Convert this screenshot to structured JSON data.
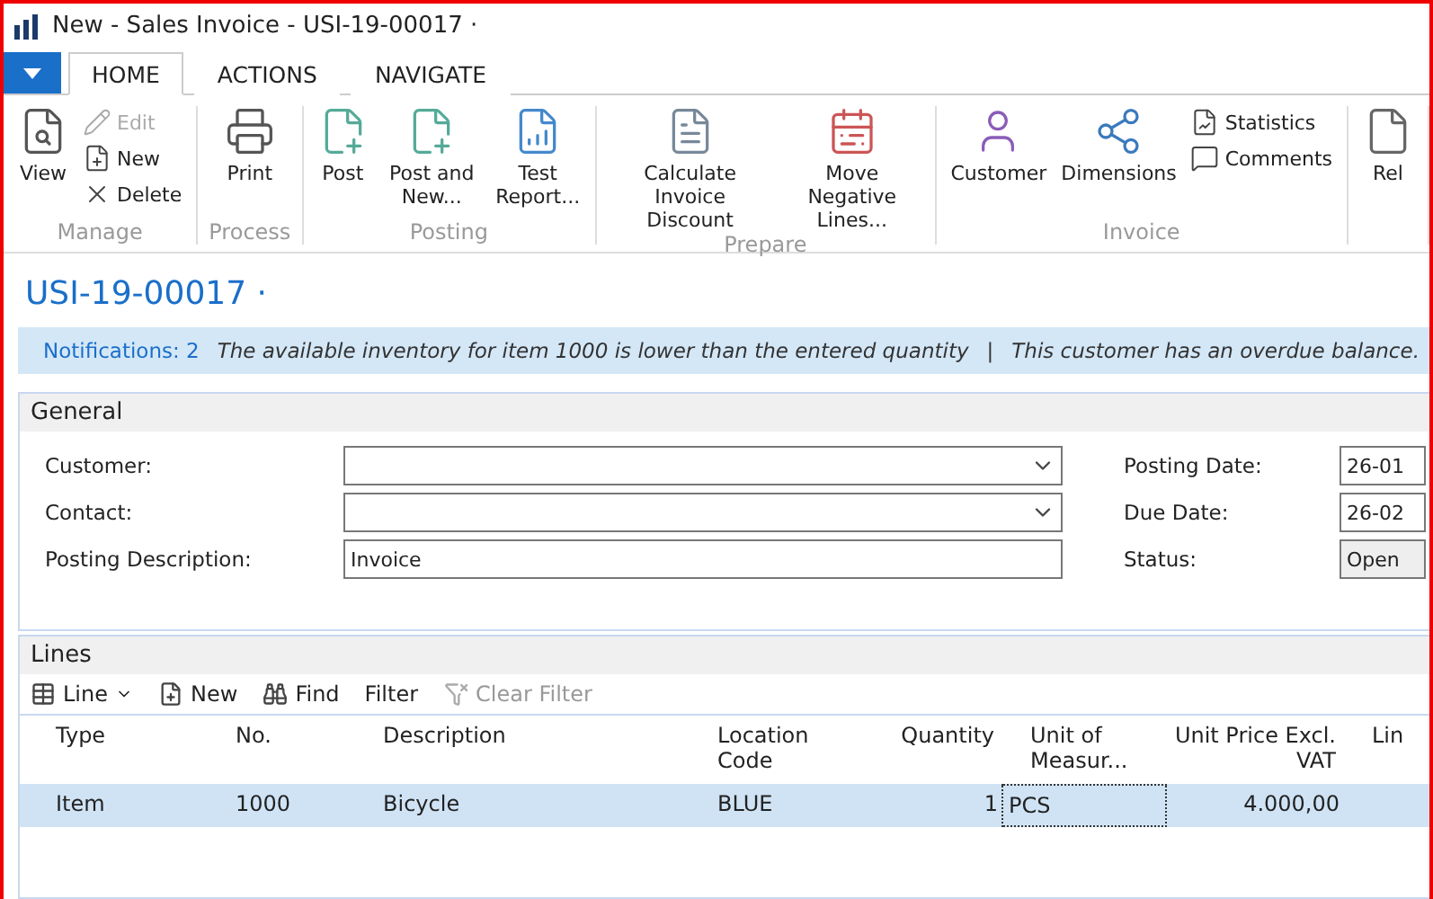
{
  "window": {
    "title": "New - Sales Invoice - USI-19-00017 ·"
  },
  "ribbon": {
    "tabs": [
      {
        "label": "HOME",
        "selected": true
      },
      {
        "label": "ACTIONS",
        "selected": false
      },
      {
        "label": "NAVIGATE",
        "selected": false
      }
    ],
    "groups": [
      {
        "label": "Manage",
        "buttons": [
          {
            "label": "View",
            "kind": "large",
            "disabled": false
          },
          {
            "label": "Edit",
            "kind": "small",
            "disabled": true
          },
          {
            "label": "New",
            "kind": "small",
            "disabled": false
          },
          {
            "label": "Delete",
            "kind": "small",
            "disabled": false
          }
        ]
      },
      {
        "label": "Process",
        "buttons": [
          {
            "label": "Print",
            "kind": "large",
            "disabled": false
          }
        ]
      },
      {
        "label": "Posting",
        "buttons": [
          {
            "label": "Post",
            "kind": "large",
            "disabled": false
          },
          {
            "label": "Post and New...",
            "kind": "large",
            "disabled": false
          },
          {
            "label": "Test Report...",
            "kind": "large",
            "disabled": false
          }
        ]
      },
      {
        "label": "Prepare",
        "buttons": [
          {
            "label": "Calculate Invoice Discount",
            "kind": "large",
            "disabled": false
          },
          {
            "label": "Move Negative Lines...",
            "kind": "large",
            "disabled": false
          }
        ]
      },
      {
        "label": "Invoice",
        "buttons": [
          {
            "label": "Customer",
            "kind": "large",
            "disabled": false
          },
          {
            "label": "Dimensions",
            "kind": "large",
            "disabled": false
          },
          {
            "label": "Statistics",
            "kind": "small",
            "disabled": false
          },
          {
            "label": "Comments",
            "kind": "small",
            "disabled": false
          }
        ]
      },
      {
        "buttons": [
          {
            "label": "Rel",
            "kind": "large",
            "disabled": false
          }
        ]
      }
    ]
  },
  "page_title": "USI-19-00017 ·",
  "notifications": {
    "count": "Notifications: 2",
    "messages": [
      "The available inventory for item 1000 is lower than the entered quantity",
      "This customer has an overdue balance."
    ],
    "separator": "|"
  },
  "general": {
    "title": "General",
    "left_fields": [
      {
        "label": "Customer:",
        "kind": "dropdown"
      },
      {
        "label": "Contact:",
        "kind": "dropdown"
      },
      {
        "label": "Posting Description:",
        "value": "Invoice",
        "kind": "text"
      }
    ],
    "right_fields": [
      {
        "label": "Posting Date:",
        "value": "26-01",
        "kind": "text"
      },
      {
        "label": "Due Date:",
        "value": "26-02",
        "kind": "text"
      },
      {
        "label": "Status:",
        "value": "Open",
        "kind": "readonly"
      }
    ]
  },
  "lines": {
    "title": "Lines",
    "toolbar": [
      {
        "label": "Line",
        "disabled": false
      },
      {
        "label": "New",
        "disabled": false
      },
      {
        "label": "Find",
        "disabled": false
      },
      {
        "label": "Filter",
        "disabled": false
      },
      {
        "label": "Clear Filter",
        "disabled": true
      }
    ],
    "columns": [
      {
        "label": "Type",
        "kind": "text"
      },
      {
        "label": "No.",
        "kind": "text"
      },
      {
        "label": "Description",
        "kind": "text"
      },
      {
        "label": "Location Code",
        "kind": "text"
      },
      {
        "label": "Quantity",
        "kind": "number"
      },
      {
        "label": "Unit of Measur...",
        "kind": "text"
      },
      {
        "label": "Unit Price Excl. VAT",
        "kind": "number"
      },
      {
        "label": "Lin",
        "kind": "text"
      }
    ],
    "rows": [
      {
        "selected": true,
        "cells": [
          {
            "text": "Item",
            "focused": false
          },
          {
            "text": "1000",
            "focused": false
          },
          {
            "text": "Bicycle",
            "focused": false
          },
          {
            "text": "BLUE",
            "focused": false
          },
          {
            "text": "1",
            "focused": false
          },
          {
            "text": "PCS",
            "focused": true
          },
          {
            "text": "4.000,00",
            "focused": false
          },
          {
            "text": "",
            "focused": false
          }
        ]
      }
    ]
  }
}
